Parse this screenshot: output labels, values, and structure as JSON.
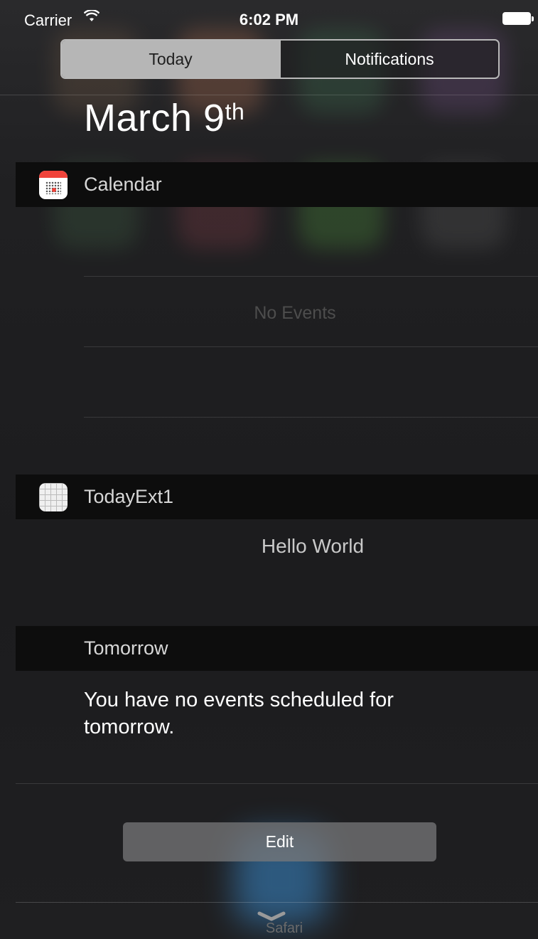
{
  "status_bar": {
    "carrier": "Carrier",
    "time": "6:02 PM"
  },
  "segmented_control": {
    "tabs": [
      {
        "label": "Today",
        "selected": true
      },
      {
        "label": "Notifications",
        "selected": false
      }
    ]
  },
  "date": {
    "month_day": "March 9",
    "suffix": "th"
  },
  "widgets": [
    {
      "title": "Calendar",
      "icon": "calendar-icon",
      "message": "No Events"
    },
    {
      "title": "TodayExt1",
      "icon": "grid-icon",
      "message": "Hello World"
    },
    {
      "title": "Tomorrow",
      "message": "You have no events scheduled for tomorrow."
    }
  ],
  "edit_label": "Edit",
  "dock": {
    "app_label": "Safari"
  },
  "colors": {
    "header_background": "#0d0d0d",
    "segment_selected": "#b6b6b6",
    "calendar_red": "#f0433a"
  }
}
